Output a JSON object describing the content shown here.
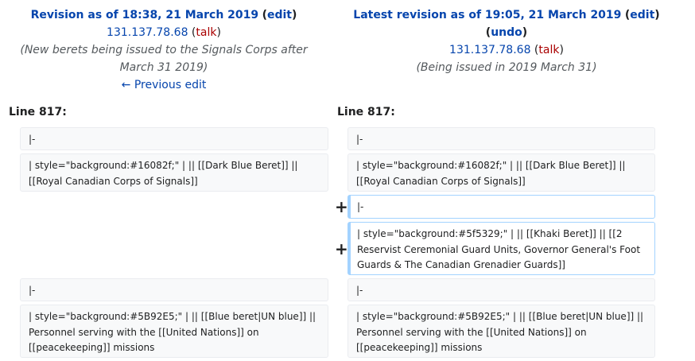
{
  "left_header": {
    "title_prefix": "Revision as of 18:38, 21 March 2019",
    "edit_label": "edit",
    "user": "131.137.78.68",
    "talk_label": "talk",
    "summary": "(New berets being issued to the Signals Corps after March 31 2019)",
    "prev_label": "← Previous edit"
  },
  "right_header": {
    "title_prefix": "Latest revision as of 19:05, 21 March 2019",
    "edit_label": "edit",
    "undo_label": "undo",
    "user": "131.137.78.68",
    "talk_label": "talk",
    "summary": "(Being issued in 2019 March 31)"
  },
  "line_label_left": "Line 817:",
  "line_label_right": "Line 817:",
  "rows": {
    "r1_left": "|-",
    "r1_right": "|-",
    "r2_left": "| style=\"background:#16082f;\" | || [[Dark Blue Beret]] || [[Royal Canadian Corps of Signals]]",
    "r2_right": "| style=\"background:#16082f;\" | || [[Dark Blue Beret]] || [[Royal Canadian Corps of Signals]]",
    "added1": "|-",
    "added2": "| style=\"background:#5f5329;\" | || [[Khaki Beret]] || [[2 Reservist Ceremonial Guard Units, Governor General's Foot Guards & The Canadian Grenadier Guards]]",
    "r3_left": "|-",
    "r3_right": "|-",
    "r4_left": "| style=\"background:#5B92E5;\" | || [[Blue beret|UN blue]] || Personnel serving with the [[United Nations]] on [[peacekeeping]] missions",
    "r4_right": "| style=\"background:#5B92E5;\" | || [[Blue beret|UN blue]] || Personnel serving with the [[United Nations]] on [[peacekeeping]] missions"
  },
  "plus_marker": "+"
}
